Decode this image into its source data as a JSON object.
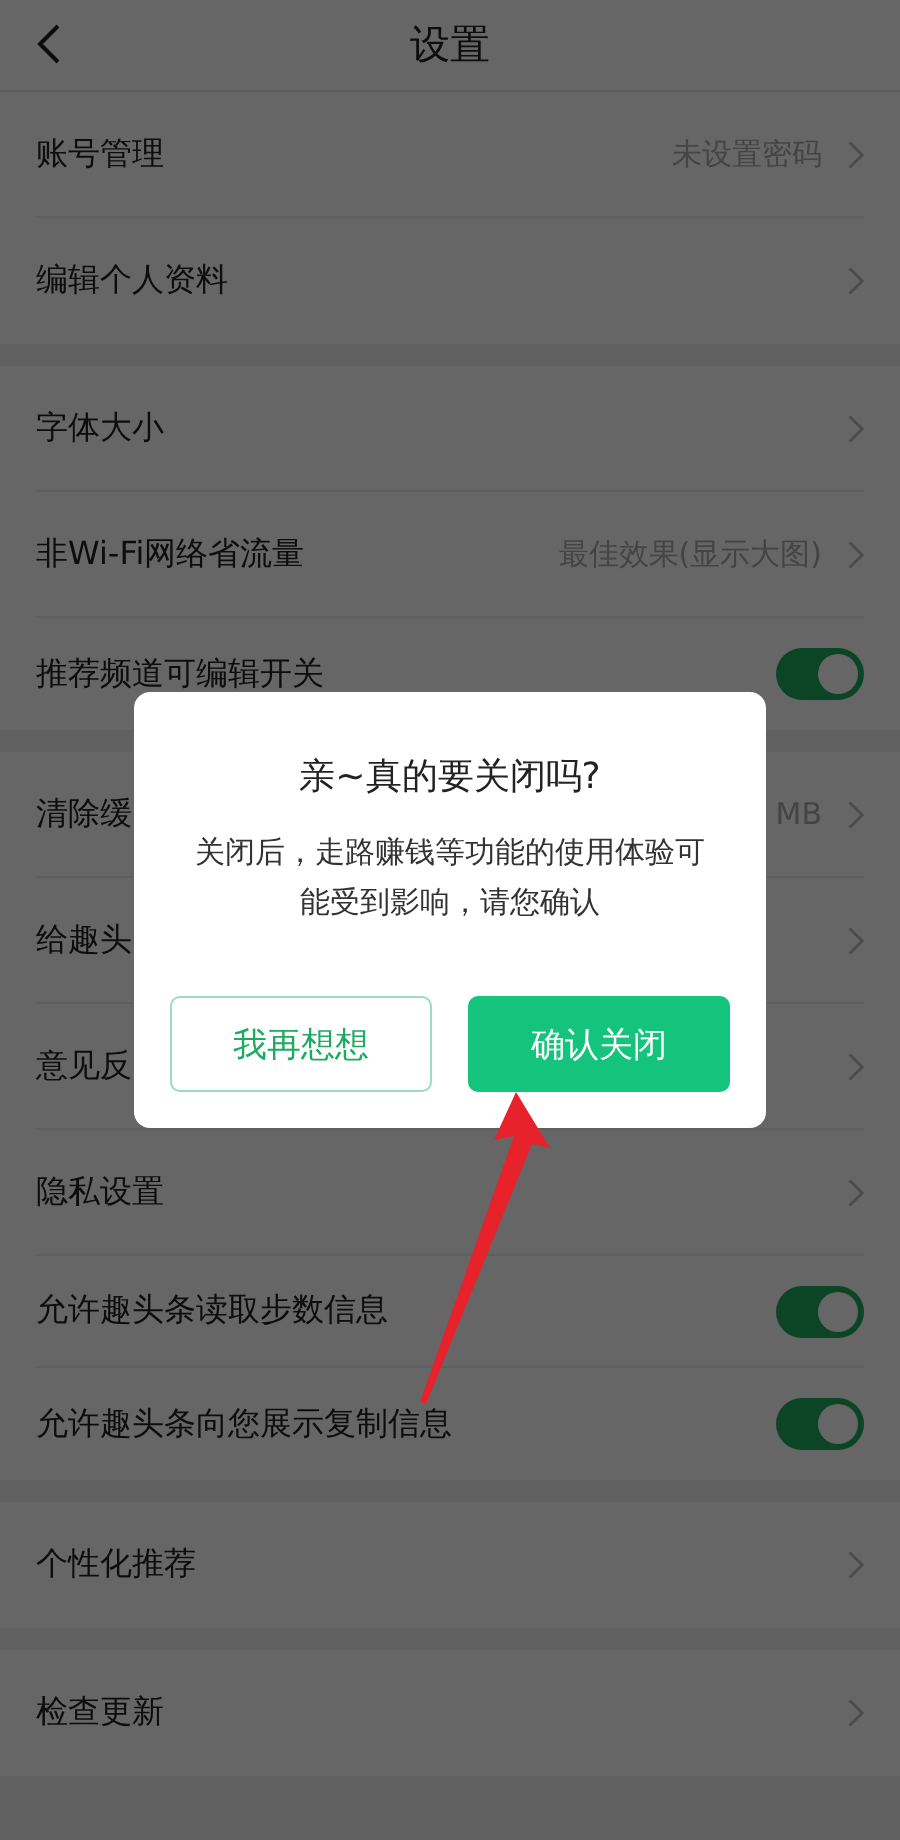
{
  "header": {
    "title": "设置"
  },
  "sections": [
    {
      "rows": [
        {
          "kind": "link",
          "label": "账号管理",
          "value": "未设置密码"
        },
        {
          "kind": "link",
          "label": "编辑个人资料"
        }
      ]
    },
    {
      "rows": [
        {
          "kind": "link",
          "label": "字体大小"
        },
        {
          "kind": "link",
          "label": "非Wi-Fi网络省流量",
          "value": "最佳效果(显示大图)"
        },
        {
          "kind": "toggle",
          "label": "推荐频道可编辑开关",
          "on": true
        }
      ]
    },
    {
      "rows": [
        {
          "kind": "link",
          "label": "清除缓",
          "value": "MB"
        },
        {
          "kind": "link",
          "label": "给趣头"
        },
        {
          "kind": "link",
          "label": "意见反"
        },
        {
          "kind": "link",
          "label": "隐私设置"
        },
        {
          "kind": "toggle",
          "label": "允许趣头条读取步数信息",
          "on": true
        },
        {
          "kind": "toggle",
          "label": "允许趣头条向您展示复制信息",
          "on": true
        }
      ]
    },
    {
      "rows": [
        {
          "kind": "link",
          "label": "个性化推荐"
        }
      ]
    },
    {
      "rows": [
        {
          "kind": "link",
          "label": "检查更新"
        }
      ]
    }
  ],
  "dialog": {
    "title": "亲~真的要关闭吗?",
    "message": "关闭后，走路赚钱等功能的使用体验可能受到影响，请您确认",
    "buttons": [
      {
        "kind": "secondary",
        "label": "我再想想"
      },
      {
        "kind": "primary",
        "label": "确认关闭"
      }
    ]
  }
}
